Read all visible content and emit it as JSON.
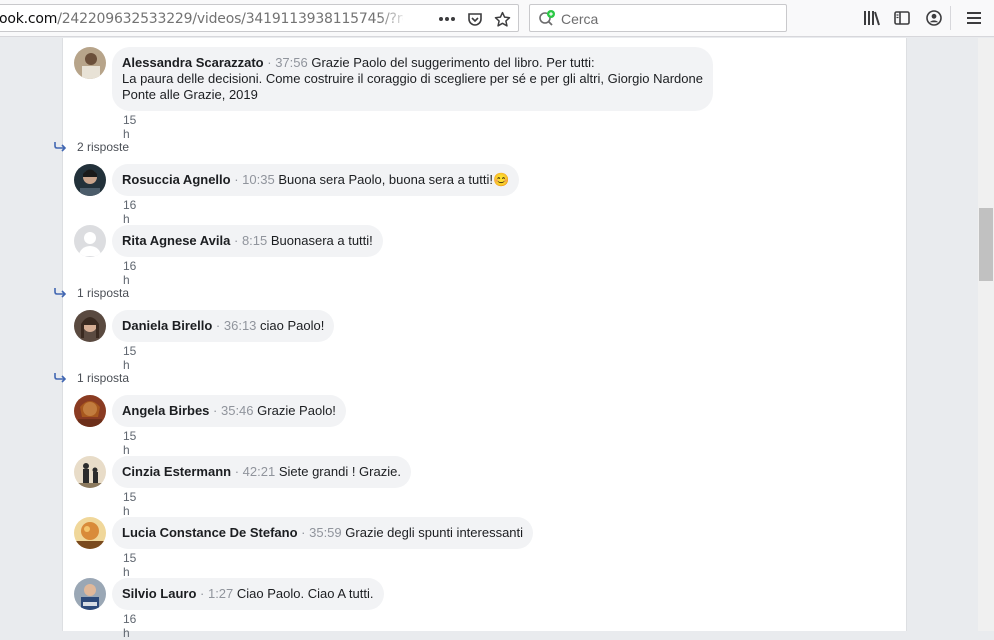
{
  "browser": {
    "url_host": "ook.com",
    "url_path": "/242209632533229/videos/3419113938115745/?redire",
    "search_placeholder": "Cerca"
  },
  "comments": [
    {
      "author": "Alessandra Scarazzato",
      "timestamp": "37:56",
      "text_lines": [
        "Grazie Paolo del suggerimento del libro. Per tutti:",
        "La paura delle decisioni. Come costruire il coraggio di scegliere per sé e per gli altri, Giorgio Nardone",
        "Ponte alle Grazie, 2019"
      ],
      "age": "15 h",
      "replies": "2 risposte"
    },
    {
      "author": "Rosuccia Agnello",
      "timestamp": "10:35",
      "text": "Buona sera Paolo, buona sera a tutti!",
      "emoji": "😊",
      "age": "16 h"
    },
    {
      "author": "Rita Agnese Avila",
      "timestamp": "8:15",
      "text": "Buonasera a tutti!",
      "age": "16 h",
      "replies": "1 risposta"
    },
    {
      "author": "Daniela Birello",
      "timestamp": "36:13",
      "text": "ciao Paolo!",
      "age": "15 h",
      "replies": "1 risposta"
    },
    {
      "author": "Angela Birbes",
      "timestamp": "35:46",
      "text": "Grazie Paolo!",
      "age": "15 h"
    },
    {
      "author": "Cinzia Estermann",
      "timestamp": "42:21",
      "text": "Siete grandi ! Grazie.",
      "age": "15 h"
    },
    {
      "author": "Lucia Constance De Stefano",
      "timestamp": "35:59",
      "text": "Grazie degli spunti interessanti",
      "age": "15 h"
    },
    {
      "author": "Silvio Lauro",
      "timestamp": "1:27",
      "text": "Ciao Paolo. Ciao A tutti.",
      "age": "16 h"
    }
  ],
  "colors": {
    "accent": "#4267b2",
    "bubble": "#f2f3f5",
    "search_badge": "#2ac845"
  }
}
